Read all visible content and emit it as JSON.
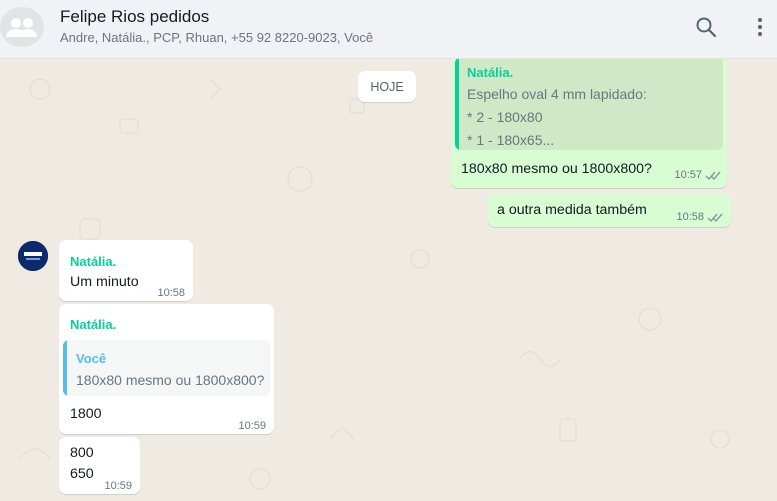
{
  "header": {
    "title": "Felipe Rios pedidos",
    "participants": "Andre, Natália., PCP, Rhuan, +55 92 8220-9023, Você",
    "icons": [
      "group-avatar-icon",
      "search-icon",
      "menu-icon"
    ]
  },
  "chat": {
    "date_label": "HOJE",
    "messages": [
      {
        "direction": "out",
        "quoted_sender": "Natália.",
        "quoted_lines": [
          "Espelho oval 4 mm lapidado:",
          "* 2 - 180x80",
          "* 1 - 180x65..."
        ],
        "text": "180x80 mesmo ou 1800x800?",
        "time": "10:57",
        "status": "read"
      },
      {
        "direction": "out",
        "text": "a outra medida também",
        "time": "10:58",
        "status": "read"
      },
      {
        "direction": "in",
        "sender": "Natália.",
        "text": "Um minuto",
        "time": "10:58"
      },
      {
        "direction": "in",
        "sender": "Natália.",
        "quoted_sender": "Você",
        "quoted_text": "180x80 mesmo ou 1800x800?",
        "text": "1800",
        "time": "10:59"
      },
      {
        "direction": "in",
        "lines": [
          "800",
          "650"
        ],
        "time": "10:59"
      }
    ]
  },
  "colors": {
    "outgoing_bubble": "#d9fdd3",
    "incoming_bubble": "#ffffff",
    "sender_name": "#06cf9c",
    "quote_you": "#53bdeb",
    "chat_background": "#efeae2",
    "read_ticks": "#8696a0"
  }
}
